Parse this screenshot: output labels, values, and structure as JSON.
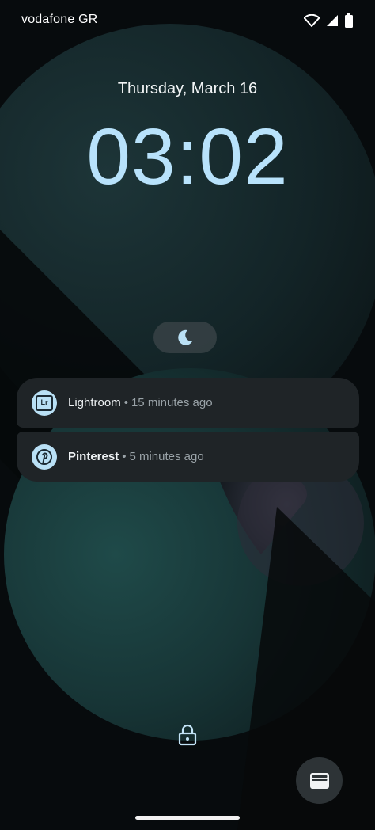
{
  "status_bar": {
    "carrier": "vodafone GR",
    "icons": [
      "wifi-icon",
      "signal-icon",
      "battery-icon"
    ]
  },
  "lockscreen": {
    "date": "Thursday, March 16",
    "time": "03:02",
    "clock_color": "#b8e2fb"
  },
  "dnd_chip": {
    "icon": "moon-icon"
  },
  "notifications": [
    {
      "app": "Lightroom",
      "icon": "lightroom-icon",
      "icon_text": "Lr",
      "separator": "•",
      "time_ago": "15 minutes ago"
    },
    {
      "app": "Pinterest",
      "icon": "pinterest-icon",
      "separator": "•",
      "time_ago": "5 minutes ago"
    }
  ],
  "bottom": {
    "lock_icon": "lock-icon",
    "wallet_icon": "wallet-icon"
  },
  "colors": {
    "notification_bg": "#1f2427",
    "accent": "#b8e2fb"
  }
}
